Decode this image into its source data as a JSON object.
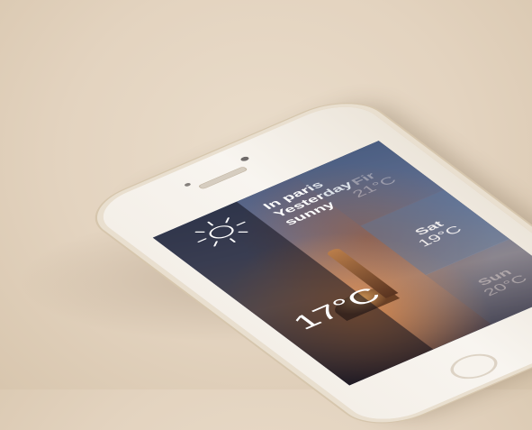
{
  "weather": {
    "city_line": "In paris",
    "day_line": "Yesterday",
    "condition": "sunny",
    "temperature": "17°C",
    "icon": "sun-icon"
  },
  "forecast": [
    {
      "day": "Fir",
      "temp": "21°C"
    },
    {
      "day": "Sat",
      "temp": "19°C"
    },
    {
      "day": "Sun",
      "temp": "20°C"
    }
  ],
  "colors": {
    "background": "#e3d3bf",
    "phone_body": "#f4efe8",
    "panel": "#506e96",
    "text": "#ffffff"
  }
}
